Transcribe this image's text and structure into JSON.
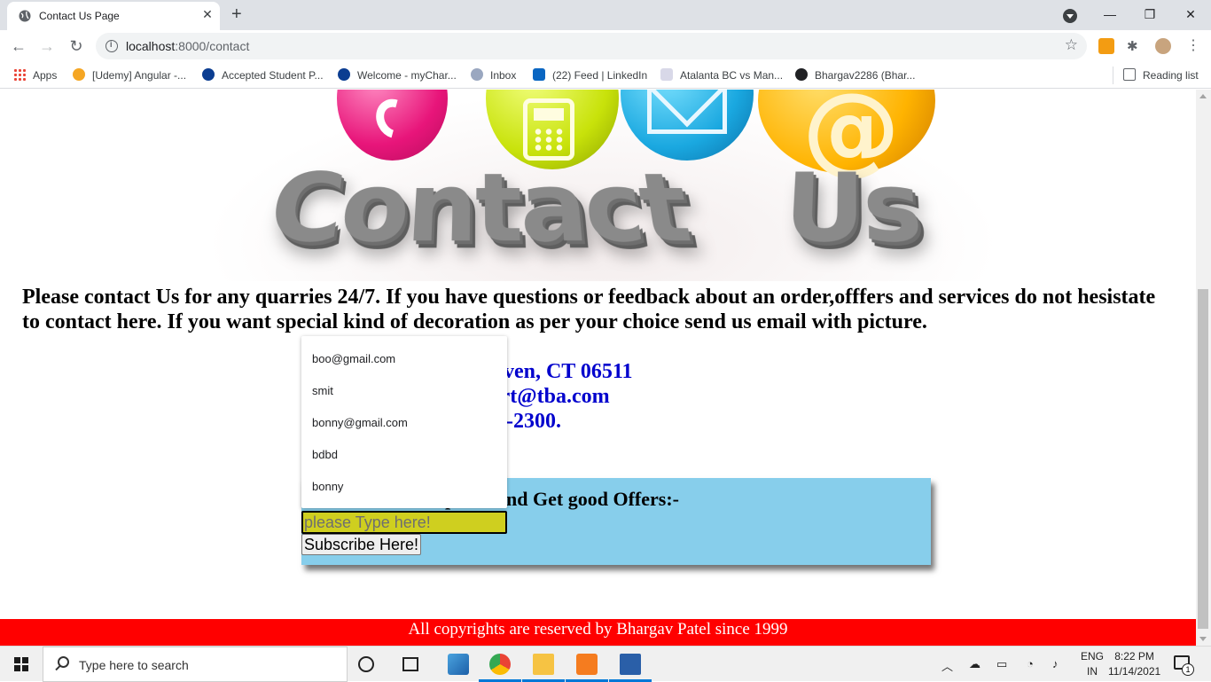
{
  "browser": {
    "tab_title": "Contact Us Page",
    "url_host": "localhost",
    "url_rest": ":8000/contact",
    "bookmarks": [
      {
        "label": "Apps"
      },
      {
        "label": "[Udemy] Angular -..."
      },
      {
        "label": "Accepted Student P..."
      },
      {
        "label": "Welcome - myChar..."
      },
      {
        "label": "Inbox"
      },
      {
        "label": "(22) Feed | LinkedIn"
      },
      {
        "label": "Atalanta BC vs Man..."
      },
      {
        "label": "Bhargav2286 (Bhar..."
      }
    ],
    "reading_list": "Reading list"
  },
  "page": {
    "hero": {
      "word1": "Contact",
      "word2": "Us"
    },
    "intro": "Please contact Us for any quarries 24/7. If you have questions or feedback about an order,offfers and services do not hesistate to contact here. If you want special kind of decoration as per your choice send us email with picture.",
    "contact_lines": [
      ":- 149 Elm St, New Haven, CT 06511",
      "ress:- customer-support@tba.com",
      "t number:- +1-203-432-2300."
    ],
    "subscribe": {
      "heading": "ress For Subscription And Get good Offers:-",
      "placeholder": "please Type here!",
      "button": "Subscribe Here!"
    },
    "autocomplete": [
      "boo@gmail.com",
      "smit",
      "bonny@gmail.com",
      "bdbd",
      "bonny"
    ],
    "footer": "All copyrights are reserved by Bhargav Patel since 1999"
  },
  "taskbar": {
    "search_placeholder": "Type here to search",
    "lang_line1": "ENG",
    "lang_line2": "IN",
    "time": "8:22 PM",
    "date": "11/14/2021",
    "notification_count": "1"
  }
}
